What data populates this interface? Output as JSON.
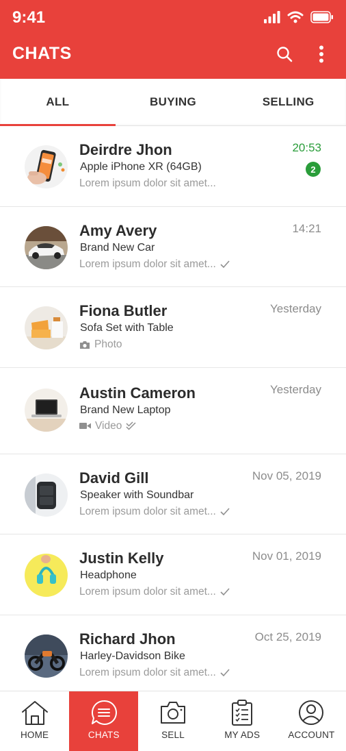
{
  "status": {
    "time": "9:41"
  },
  "header": {
    "title": "CHATS",
    "brand_color": "#e8413b"
  },
  "tabs": [
    {
      "label": "ALL",
      "active": true
    },
    {
      "label": "BUYING",
      "active": false
    },
    {
      "label": "SELLING",
      "active": false
    }
  ],
  "chats": [
    {
      "name": "Deirdre Jhon",
      "product": "Apple iPhone XR (64GB)",
      "preview": "Lorem ipsum dolor sit amet...",
      "time": "20:53",
      "unread": "2",
      "avatar": "phone-image"
    },
    {
      "name": "Amy Avery",
      "product": "Brand New Car",
      "preview": "Lorem ipsum dolor sit amet...",
      "time": "14:21",
      "status": "sent-check",
      "avatar": "car-image"
    },
    {
      "name": "Fiona Butler",
      "product": "Sofa Set with Table",
      "preview": "Photo",
      "time": "Yesterday",
      "preview_icon": "camera-icon",
      "avatar": "sofa-image"
    },
    {
      "name": "Austin Cameron",
      "product": "Brand New Laptop",
      "preview": "Video",
      "time": "Yesterday",
      "preview_icon": "video-icon",
      "status": "read-double-check",
      "avatar": "laptop-image"
    },
    {
      "name": "David Gill",
      "product": "Speaker with Soundbar",
      "preview": "Lorem ipsum dolor sit amet...",
      "time": "Nov 05, 2019",
      "status": "sent-check",
      "avatar": "speaker-image"
    },
    {
      "name": "Justin Kelly",
      "product": "Headphone",
      "preview": "Lorem ipsum dolor sit amet...",
      "time": "Nov 01, 2019",
      "status": "sent-check",
      "avatar": "headphone-image"
    },
    {
      "name": "Richard Jhon",
      "product": "Harley-Davidson Bike",
      "preview": "Lorem ipsum dolor sit amet...",
      "time": "Oct 25, 2019",
      "status": "sent-check",
      "avatar": "bike-image"
    }
  ],
  "bottom_nav": [
    {
      "label": "HOME",
      "icon": "home-icon"
    },
    {
      "label": "CHATS",
      "icon": "chat-icon",
      "active": true
    },
    {
      "label": "SELL",
      "icon": "camera-icon"
    },
    {
      "label": "MY ADS",
      "icon": "clipboard-icon"
    },
    {
      "label": "ACCOUNT",
      "icon": "account-icon"
    }
  ]
}
